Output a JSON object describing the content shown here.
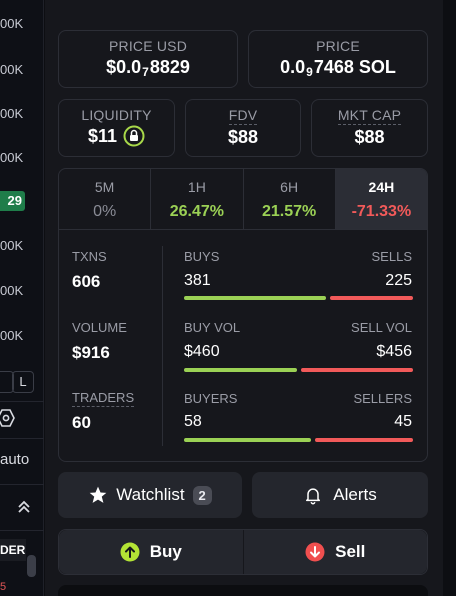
{
  "left_column": {
    "axis_values": [
      "00K",
      "00K",
      "00K",
      "00K",
      "00K",
      "00K",
      "00K"
    ],
    "highlight_badge": "29",
    "buttons": [
      "",
      "L"
    ],
    "auto_label": "auto",
    "der_label": "DER",
    "red_value": "5"
  },
  "price_usd": {
    "label": "PRICE USD",
    "prefix": "$0.0",
    "subscript": "7",
    "suffix": "8829"
  },
  "price_sol": {
    "label": "PRICE",
    "prefix": "0.0",
    "subscript": "9",
    "suffix": "7468 SOL"
  },
  "liquidity": {
    "label": "LIQUIDITY",
    "value": "$11"
  },
  "fdv": {
    "label": "FDV",
    "value": "$88"
  },
  "mkt_cap": {
    "label": "MKT CAP",
    "value": "$88"
  },
  "timeframes": [
    {
      "label": "5M",
      "value": "0%",
      "color": "#8a8c96",
      "active": false
    },
    {
      "label": "1H",
      "value": "26.47%",
      "color": "#9bd155",
      "active": false
    },
    {
      "label": "6H",
      "value": "21.57%",
      "color": "#9bd155",
      "active": false
    },
    {
      "label": "24H",
      "value": "-71.33%",
      "color": "#f25a5a",
      "active": true
    }
  ],
  "stats": {
    "txns": {
      "label": "TXNS",
      "value": "606"
    },
    "volume": {
      "label": "VOLUME",
      "value": "$916"
    },
    "traders": {
      "label": "TRADERS",
      "value": "60"
    },
    "buys": {
      "label": "BUYS",
      "value": "381"
    },
    "sells": {
      "label": "SELLS",
      "value": "225"
    },
    "buy_vol": {
      "label": "BUY VOL",
      "value": "$460"
    },
    "sell_vol": {
      "label": "SELL VOL",
      "value": "$456"
    },
    "buyers": {
      "label": "BUYERS",
      "value": "58"
    },
    "sellers": {
      "label": "SELLERS",
      "value": "45"
    },
    "buy_ratios": [
      0.629,
      0.502,
      0.563
    ]
  },
  "colors": {
    "green": "#9bd155",
    "red": "#f25a5a",
    "buy_icon": "#b3e335",
    "sell_icon": "#f04f4f"
  },
  "actions": {
    "watchlist_label": "Watchlist",
    "watchlist_count": "2",
    "alerts_label": "Alerts",
    "buy_label": "Buy",
    "sell_label": "Sell"
  }
}
